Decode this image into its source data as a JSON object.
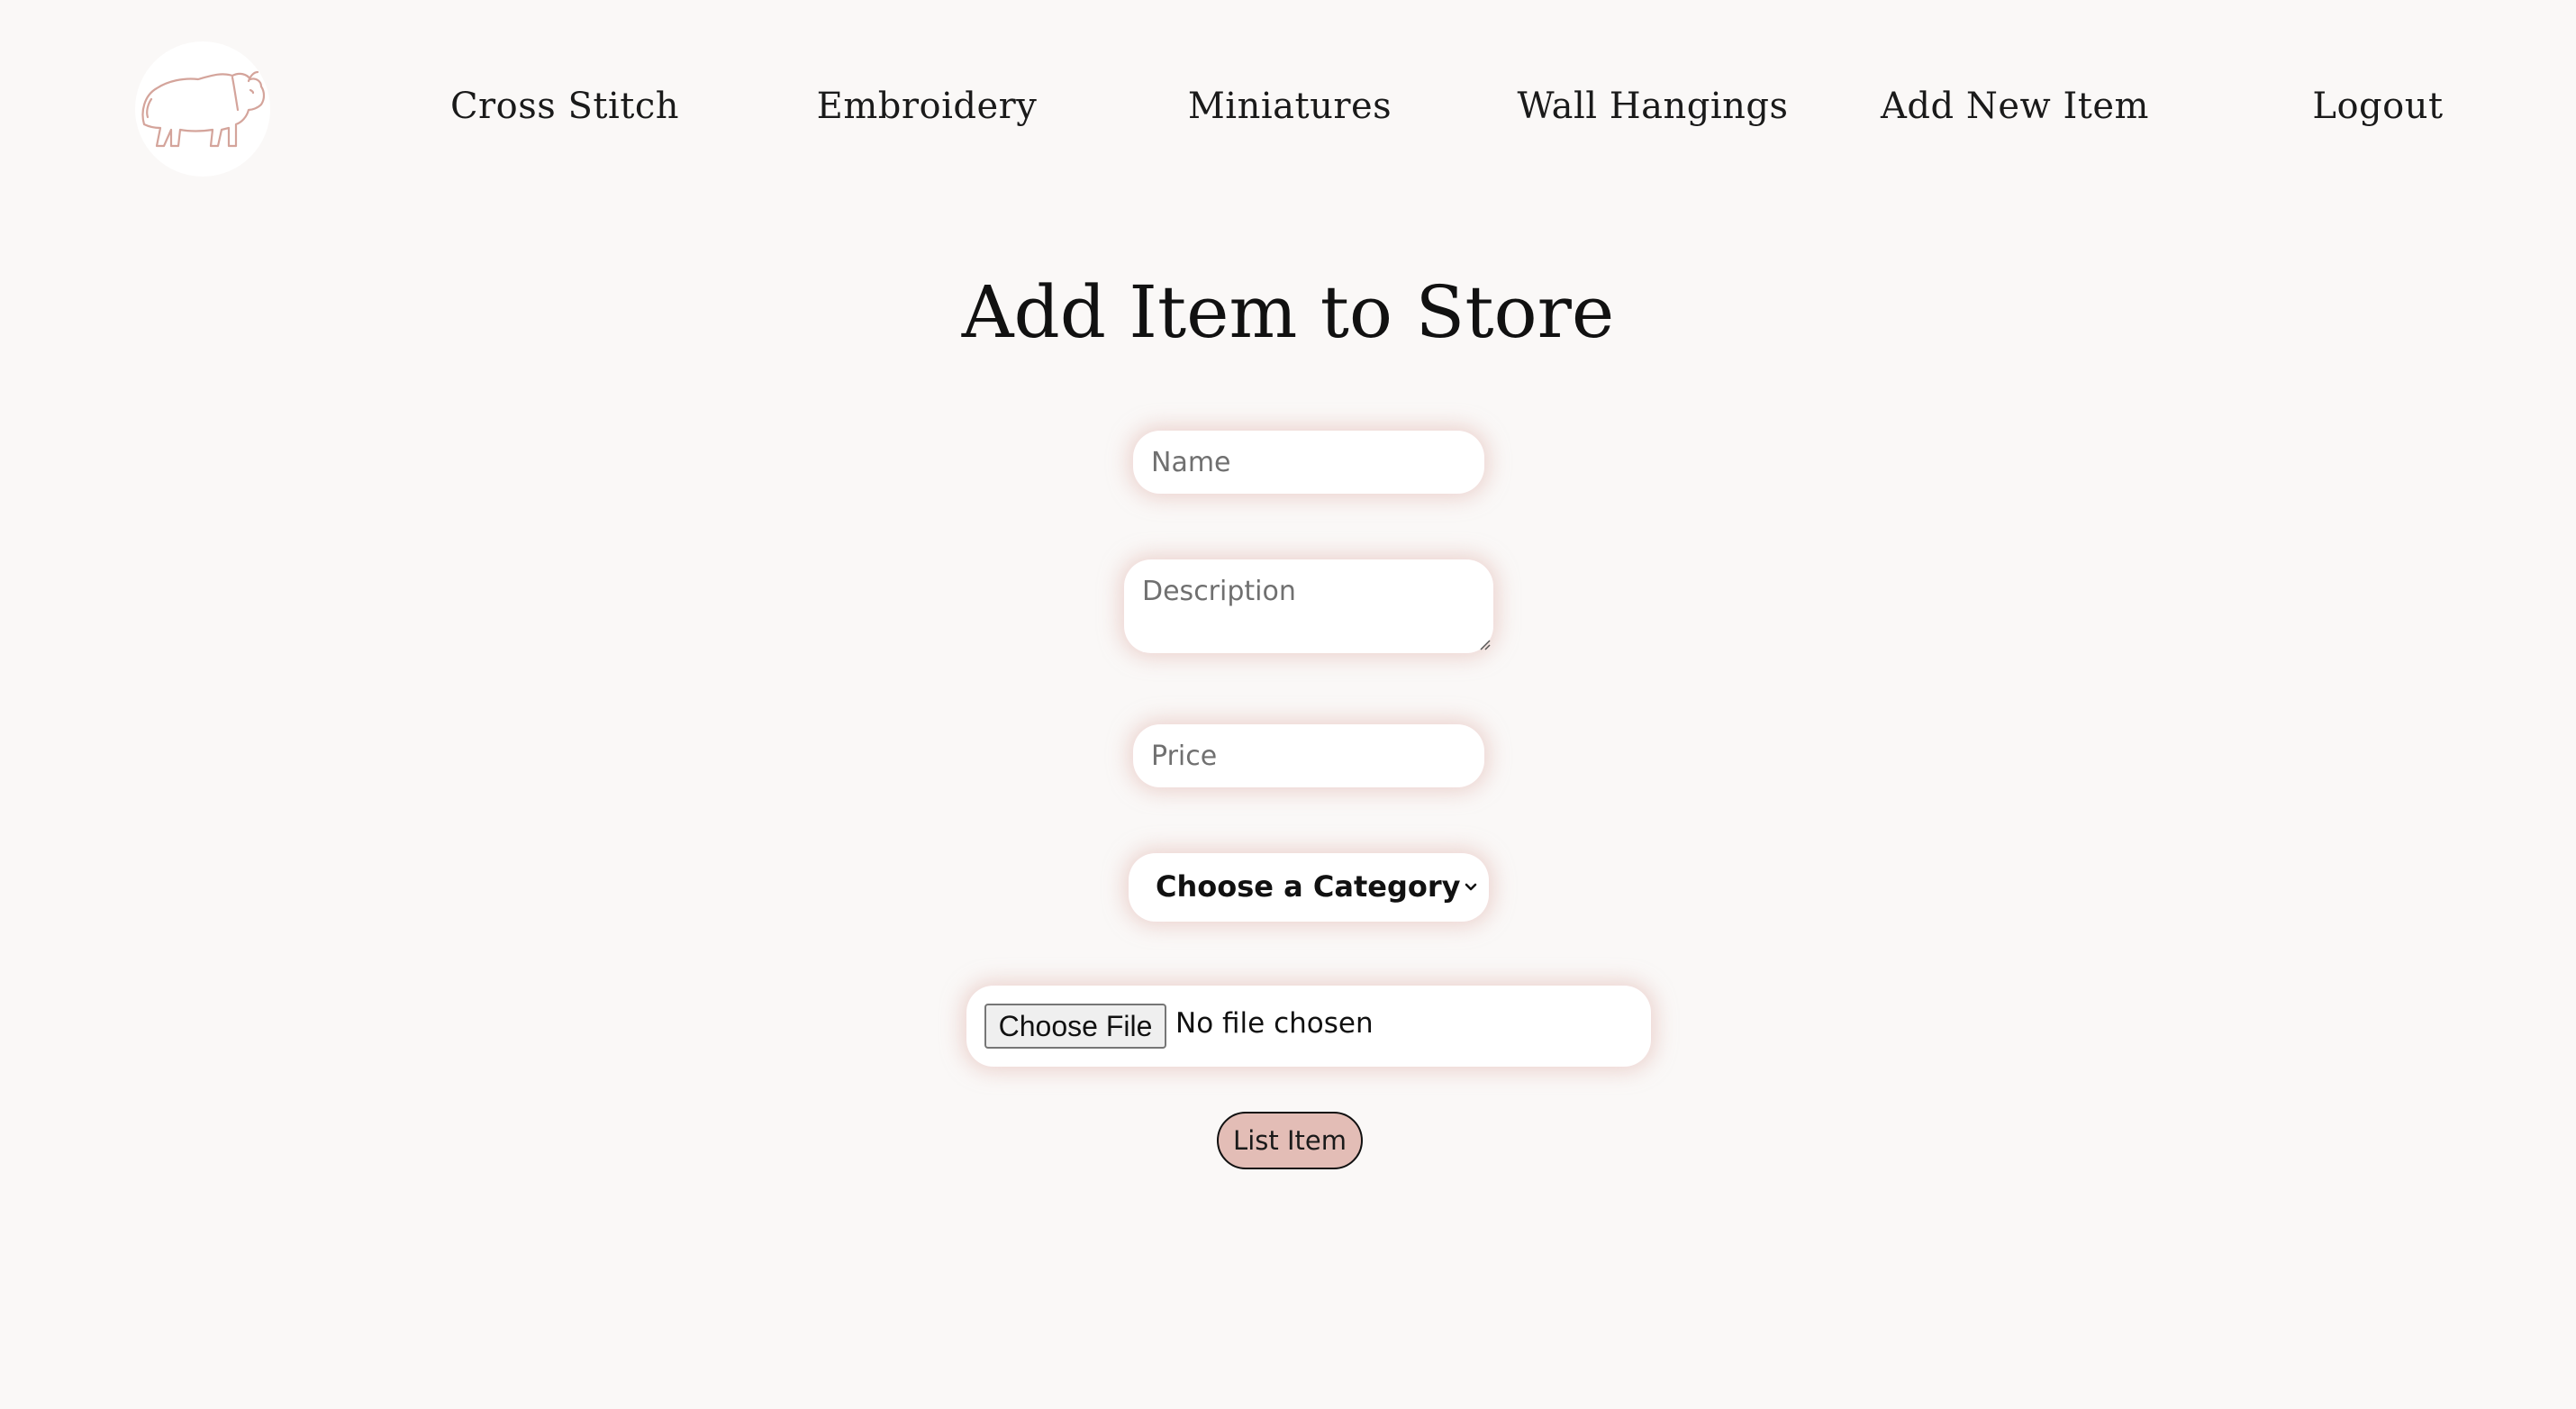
{
  "nav": {
    "logo_icon": "bison-icon",
    "links": [
      {
        "label": "Cross Stitch"
      },
      {
        "label": "Embroidery"
      },
      {
        "label": "Miniatures"
      },
      {
        "label": "Wall Hangings"
      },
      {
        "label": "Add New Item"
      },
      {
        "label": "Logout"
      }
    ]
  },
  "page": {
    "title": "Add Item to Store"
  },
  "form": {
    "name_placeholder": "Name",
    "description_placeholder": "Description",
    "price_placeholder": "Price",
    "category_selected": "Choose a Category",
    "file_button_label": "Choose File",
    "file_status": "No file chosen",
    "submit_label": "List Item"
  },
  "colors": {
    "background": "#faf8f7",
    "accent": "#e3bdb6",
    "logo_stroke": "#d4a49b"
  }
}
